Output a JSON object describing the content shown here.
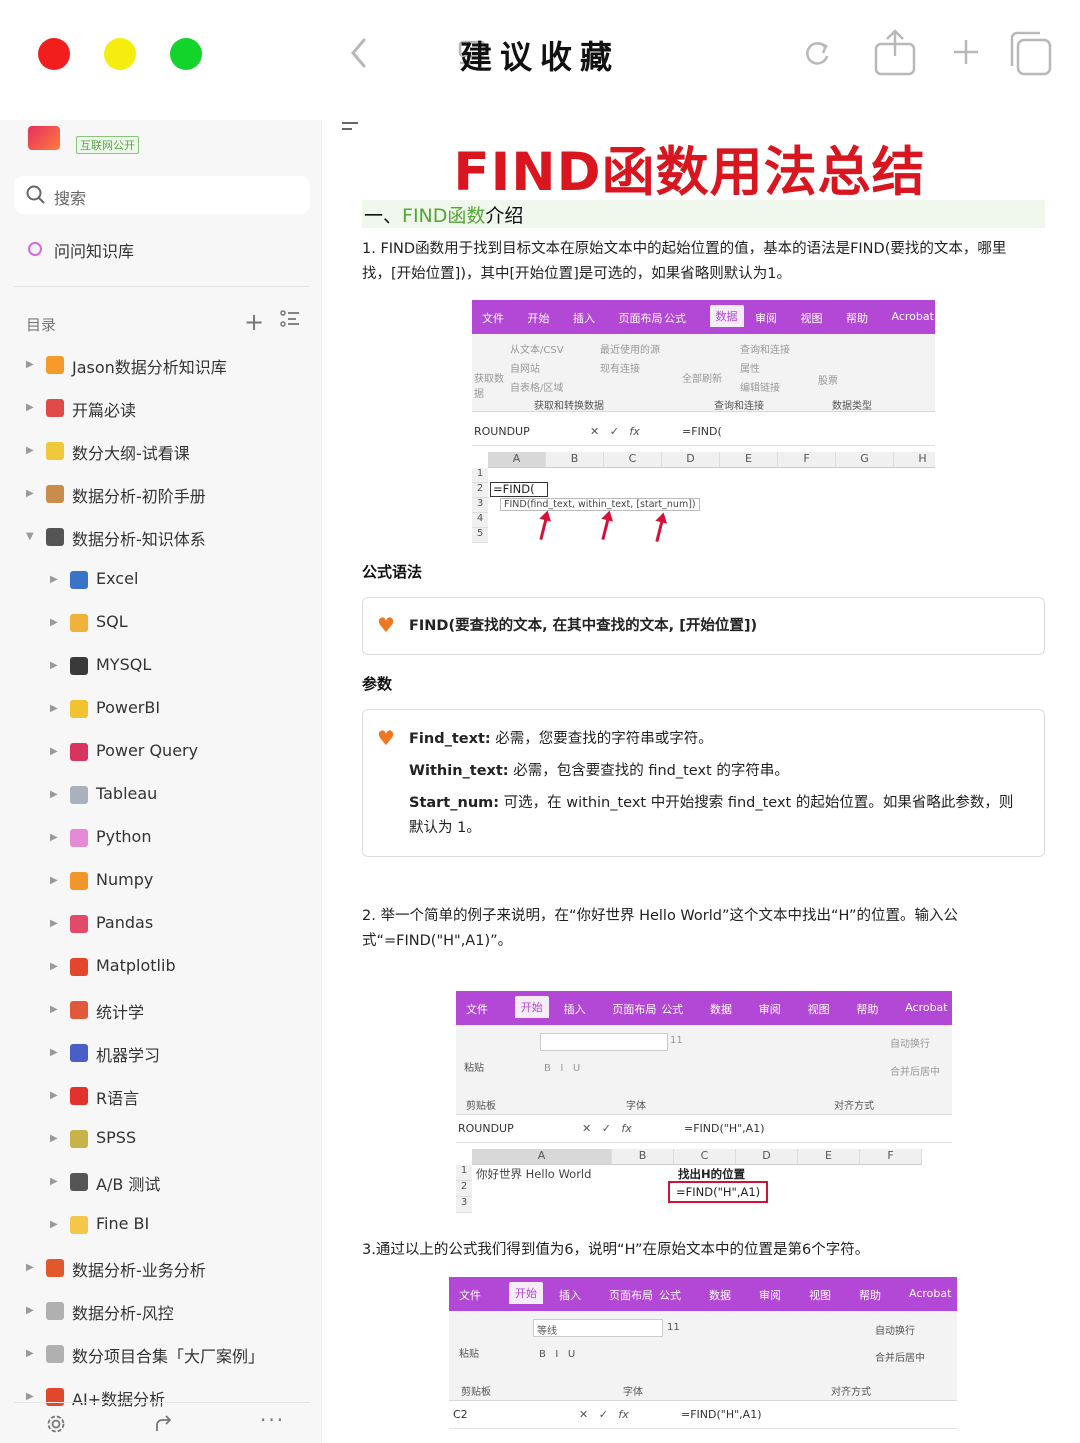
{
  "window": {
    "title": "建议收藏"
  },
  "sidebar": {
    "badge": "互联网公开",
    "search_placeholder": "搜索",
    "kb_label": "问问知识库",
    "toc_title": "目录",
    "items": [
      {
        "label": "Jason数据分析知识库",
        "level": 0,
        "icon_color": "#f59b2b"
      },
      {
        "label": "开篇必读",
        "level": 0,
        "icon_color": "#e24a4a"
      },
      {
        "label": "数分大纲-试看课",
        "level": 0,
        "icon_color": "#f0c93a"
      },
      {
        "label": "数据分析-初阶手册",
        "level": 0,
        "icon_color": "#c98c4a"
      },
      {
        "label": "数据分析-知识体系",
        "level": 0,
        "icon_color": "#555555"
      },
      {
        "label": "Excel",
        "level": 1,
        "icon_color": "#3b73c7"
      },
      {
        "label": "SQL",
        "level": 1,
        "icon_color": "#f0b23a"
      },
      {
        "label": "MYSQL",
        "level": 1,
        "icon_color": "#3a3a3a"
      },
      {
        "label": "PowerBI",
        "level": 1,
        "icon_color": "#f2c230"
      },
      {
        "label": "Power Query",
        "level": 1,
        "icon_color": "#d8345f"
      },
      {
        "label": "Tableau",
        "level": 1,
        "icon_color": "#a9b1bd"
      },
      {
        "label": "Python",
        "level": 1,
        "icon_color": "#e58bd6"
      },
      {
        "label": "Numpy",
        "level": 1,
        "icon_color": "#f0962a"
      },
      {
        "label": "Pandas",
        "level": 1,
        "icon_color": "#e24a6a"
      },
      {
        "label": "Matplotlib",
        "level": 1,
        "icon_color": "#e2472b"
      },
      {
        "label": "统计学",
        "level": 1,
        "icon_color": "#e2583a"
      },
      {
        "label": "机器学习",
        "level": 1,
        "icon_color": "#4a5ec7"
      },
      {
        "label": "R语言",
        "level": 1,
        "icon_color": "#e2322b"
      },
      {
        "label": "SPSS",
        "level": 1,
        "icon_color": "#c8b24a"
      },
      {
        "label": "A/B 测试",
        "level": 1,
        "icon_color": "#555555"
      },
      {
        "label": "Fine BI",
        "level": 1,
        "icon_color": "#f4c64a"
      },
      {
        "label": "数据分析-业务分析",
        "level": 0,
        "icon_color": "#e2572b"
      },
      {
        "label": "数据分析-风控",
        "level": 0,
        "icon_color": "#b0b0b0"
      },
      {
        "label": "数分项目合集「大厂案例」",
        "level": 0,
        "icon_color": "#b0b0b0"
      },
      {
        "label": "AI+数据分析",
        "level": 0,
        "icon_color": "#e2472b"
      }
    ]
  },
  "doc": {
    "title": "FIND函数用法总结",
    "section1": {
      "prefix": "一、",
      "highlight": "FIND函数",
      "suffix": "介绍"
    },
    "p1_line1": "1. FIND函数用于找到目标文本在原始文本中的起始位置的值，基本的语法是FIND(要找的文本，哪里",
    "p1_line2": "找，[开始位置])，其中[开始位置]是可选的，如果省略则默认为1。",
    "syntax_heading": "公式语法",
    "syntax_text": "FIND(要查找的文本, 在其中查找的文本, [开始位置])",
    "params_heading": "参数",
    "param1_name": "Find_text:",
    "param1_desc": " 必需，您要查找的字符串或字符。",
    "param2_name": "Within_text:",
    "param2_desc": " 必需，包含要查找的 find_text 的字符串。",
    "param3_name": "Start_num:",
    "param3_desc": " 可选，在 within_text 中开始搜索 find_text 的起始位置。如果省略此参数，则",
    "param3_desc2": "默认为 1。",
    "p2_line1": "2. 举一个简单的例子来说明，在“你好世界 Hello World”这个文本中找出“H”的位置。输入公",
    "p2_line2": "式“=FIND(\"H\",A1)”。",
    "p3": "3.通过以上的公式我们得到值为6，说明“H”在原始文本中的位置是第6个字符。"
  },
  "excel1": {
    "tabs": [
      "文件",
      "开始",
      "插入",
      "页面布局",
      "公式",
      "数据",
      "审阅",
      "视图",
      "帮助",
      "Acrobat"
    ],
    "active_tab": "数据",
    "ribbon": [
      "从文本/CSV",
      "最近使用的源",
      "自网站",
      "现有连接",
      "自表格/区域",
      "获取数据",
      "全部刷新",
      "查询和连接",
      "属性",
      "编辑链接",
      "股票",
      "获取和转换数据",
      "查询和连接",
      "数据类型"
    ],
    "namebox": "ROUNDUP",
    "formula": "=FIND(",
    "columns": [
      "A",
      "B",
      "C",
      "D",
      "E",
      "F",
      "G",
      "H"
    ],
    "rows": [
      "1",
      "2",
      "3",
      "4",
      "5"
    ],
    "cell_a2": "=FIND(",
    "tooltip": "FIND(find_text, within_text, [start_num])"
  },
  "excel2": {
    "tabs": [
      "文件",
      "开始",
      "插入",
      "页面布局",
      "公式",
      "数据",
      "审阅",
      "视图",
      "帮助",
      "Acrobat"
    ],
    "active_tab": "开始",
    "ribbon": [
      "粘贴",
      "剪贴板",
      "字体",
      "对齐方式",
      "自动换行",
      "合并后居中",
      "11"
    ],
    "namebox": "ROUNDUP",
    "formula": "=FIND(\"H\",A1)",
    "columns": [
      "A",
      "B",
      "C",
      "D",
      "E",
      "F"
    ],
    "rows": [
      "1",
      "2",
      "3"
    ],
    "cell_a1": "你好世界 Hello World",
    "cell_c1": "找出H的位置",
    "cell_c2": "=FIND(\"H\",A1)"
  },
  "excel3": {
    "tabs": [
      "文件",
      "开始",
      "插入",
      "页面布局",
      "公式",
      "数据",
      "审阅",
      "视图",
      "帮助",
      "Acrobat"
    ],
    "active_tab": "开始",
    "ribbon": [
      "粘贴",
      "剪贴板",
      "字体",
      "对齐方式",
      "自动换行",
      "合并后居中",
      "等线",
      "11"
    ],
    "namebox": "C2",
    "formula": "=FIND(\"H\",A1)"
  }
}
